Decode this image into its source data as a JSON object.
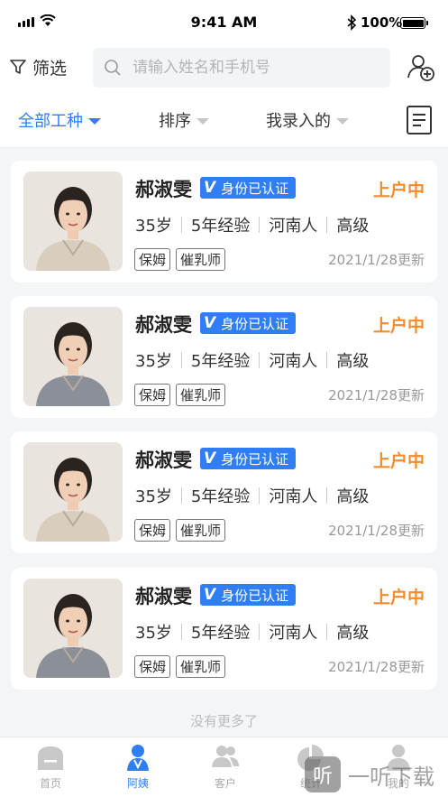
{
  "status_bar": {
    "time": "9:41 AM",
    "battery": "100%"
  },
  "header": {
    "filter_label": "筛选",
    "search_placeholder": "请输入姓名和手机号"
  },
  "filter_bar": {
    "items": [
      {
        "label": "全部工种"
      },
      {
        "label": "排序"
      },
      {
        "label": "我录入的"
      }
    ]
  },
  "cards": [
    {
      "name": "郝淑雯",
      "badge": "身份已认证",
      "status": "上户中",
      "age": "35岁",
      "experience": "5年经验",
      "origin": "河南人",
      "level": "高级",
      "tags": [
        "保姆",
        "催乳师"
      ],
      "updated": "2021/1/28更新"
    },
    {
      "name": "郝淑雯",
      "badge": "身份已认证",
      "status": "上户中",
      "age": "35岁",
      "experience": "5年经验",
      "origin": "河南人",
      "level": "高级",
      "tags": [
        "保姆",
        "催乳师"
      ],
      "updated": "2021/1/28更新"
    },
    {
      "name": "郝淑雯",
      "badge": "身份已认证",
      "status": "上户中",
      "age": "35岁",
      "experience": "5年经验",
      "origin": "河南人",
      "level": "高级",
      "tags": [
        "保姆",
        "催乳师"
      ],
      "updated": "2021/1/28更新"
    },
    {
      "name": "郝淑雯",
      "badge": "身份已认证",
      "status": "上户中",
      "age": "35岁",
      "experience": "5年经验",
      "origin": "河南人",
      "level": "高级",
      "tags": [
        "保姆",
        "催乳师"
      ],
      "updated": "2021/1/28更新"
    }
  ],
  "no_more_text": "没有更多了",
  "bottom_nav": {
    "items": [
      {
        "label": "首页"
      },
      {
        "label": "阿姨"
      },
      {
        "label": "客户"
      },
      {
        "label": "统计"
      },
      {
        "label": "我的"
      }
    ]
  },
  "watermark": {
    "logo": "听",
    "text": "一听下载"
  },
  "colors": {
    "accent": "#2f7ef5",
    "status": "#f58c2b",
    "background": "#f4f5f7"
  }
}
